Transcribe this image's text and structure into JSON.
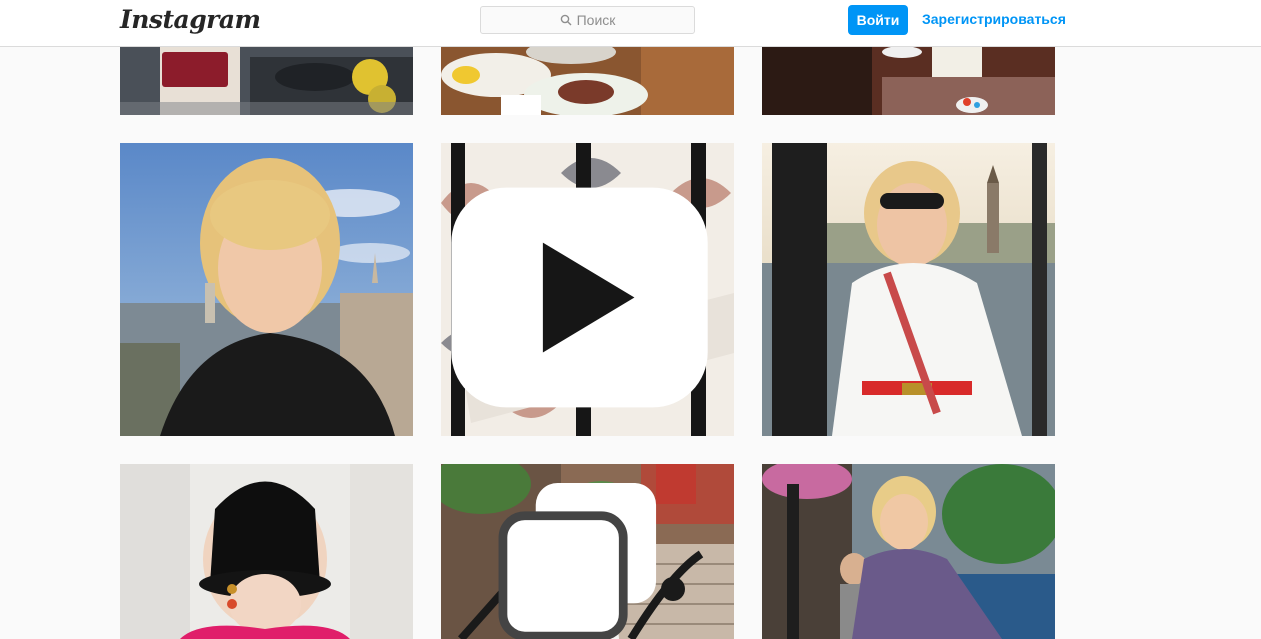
{
  "header": {
    "logo": "Instagram",
    "search_placeholder": "Поиск",
    "login_label": "Войти",
    "signup_label": "Зарегистрироваться"
  },
  "grid": {
    "posts": [
      {
        "name": "post-woman-red-bag-seaside",
        "type": "photo"
      },
      {
        "name": "post-breakfast-table",
        "type": "photo"
      },
      {
        "name": "post-sneakers-cafe",
        "type": "photo"
      },
      {
        "name": "post-selfie-istanbul-view",
        "type": "photo"
      },
      {
        "name": "post-cat-sleeping-tiles",
        "type": "video",
        "badge": "video-icon"
      },
      {
        "name": "post-woman-white-shirt-bosphorus",
        "type": "photo"
      },
      {
        "name": "post-woman-black-hat",
        "type": "photo"
      },
      {
        "name": "post-woman-brownstone-steps",
        "type": "carousel",
        "badge": "carousel-icon"
      },
      {
        "name": "post-woman-purple-shirt-street",
        "type": "photo"
      }
    ]
  },
  "colors": {
    "accent": "#0095f6",
    "background": "#fafafa",
    "border": "#dbdbdb"
  }
}
